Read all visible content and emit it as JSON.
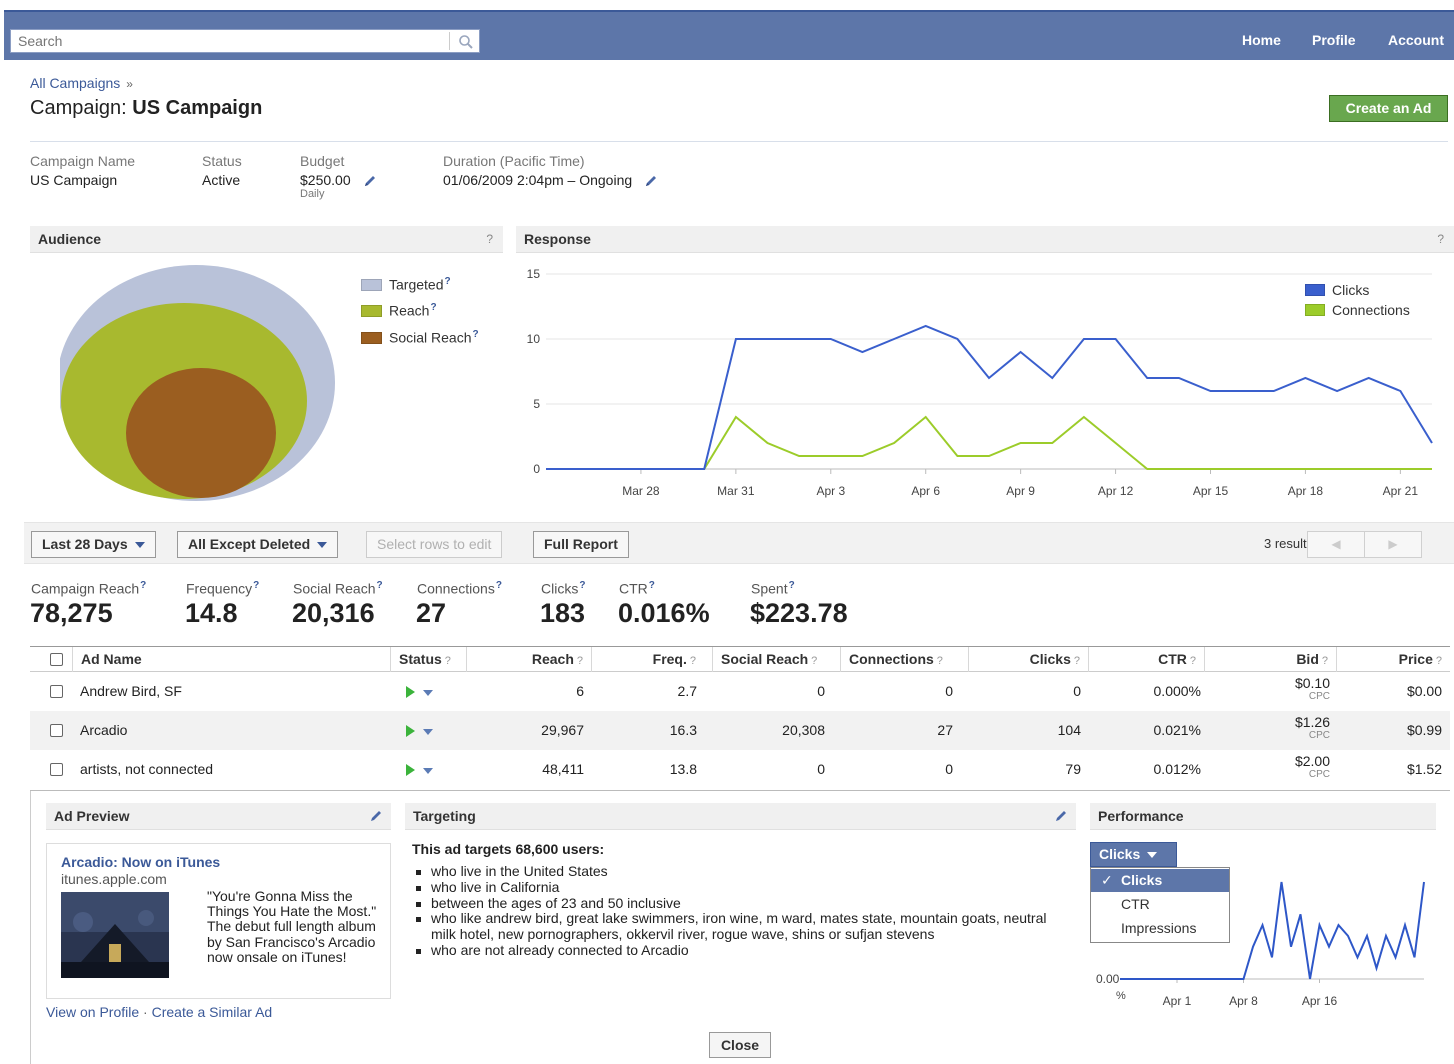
{
  "topbar": {
    "search_placeholder": "Search",
    "nav": [
      "Home",
      "Profile",
      "Account"
    ]
  },
  "breadcrumb": {
    "link": "All Campaigns",
    "sep": "»"
  },
  "page_title": {
    "prefix": "Campaign:",
    "name": "US Campaign"
  },
  "create_ad_label": "Create an Ad",
  "campaign_meta": {
    "name_label": "Campaign Name",
    "name_value": "US Campaign",
    "status_label": "Status",
    "status_value": "Active",
    "budget_label": "Budget",
    "budget_value": "$250.00",
    "budget_period": "Daily",
    "duration_label": "Duration (Pacific Time)",
    "duration_value": "01/06/2009 2:04pm – Ongoing"
  },
  "audience": {
    "title": "Audience",
    "help": "?",
    "legend": [
      {
        "label": "Targeted",
        "color": "#b9c2d9"
      },
      {
        "label": "Reach",
        "color": "#a8b92f"
      },
      {
        "label": "Social Reach",
        "color": "#9b5e20"
      }
    ]
  },
  "response": {
    "title": "Response",
    "help": "?",
    "legend": [
      {
        "label": "Clicks",
        "color": "#3a5fcd"
      },
      {
        "label": "Connections",
        "color": "#9ccc2a"
      }
    ]
  },
  "chart_data": [
    {
      "type": "line",
      "title": "Response",
      "x": [
        "Mar 25",
        "Mar 26",
        "Mar 27",
        "Mar 28",
        "Mar 29",
        "Mar 30",
        "Mar 31",
        "Apr 1",
        "Apr 2",
        "Apr 3",
        "Apr 4",
        "Apr 5",
        "Apr 6",
        "Apr 7",
        "Apr 8",
        "Apr 9",
        "Apr 10",
        "Apr 11",
        "Apr 12",
        "Apr 13",
        "Apr 14",
        "Apr 15",
        "Apr 16",
        "Apr 17",
        "Apr 18",
        "Apr 19",
        "Apr 20",
        "Apr 21"
      ],
      "x_tick_labels": [
        "Mar 28",
        "Mar 31",
        "Apr 3",
        "Apr 6",
        "Apr 9",
        "Apr 12",
        "Apr 15",
        "Apr 18",
        "Apr 21"
      ],
      "y_ticks": [
        0,
        5,
        10,
        15
      ],
      "ylim": [
        0,
        15
      ],
      "series": [
        {
          "name": "Clicks",
          "color": "#3a5fcd",
          "values": [
            0,
            0,
            0,
            0,
            0,
            0,
            10,
            10,
            10,
            10,
            9,
            10,
            11,
            10,
            7,
            9,
            7,
            10,
            10,
            7,
            7,
            6,
            6,
            6,
            7,
            6,
            7,
            6,
            2
          ]
        },
        {
          "name": "Connections",
          "color": "#9ccc2a",
          "values": [
            0,
            0,
            0,
            0,
            0,
            0,
            4,
            2,
            1,
            1,
            1,
            2,
            4,
            1,
            1,
            2,
            2,
            4,
            2,
            0,
            0,
            0,
            0,
            0,
            0,
            0,
            0,
            0,
            0
          ]
        }
      ],
      "legend_position": "top-right",
      "grid": true
    },
    {
      "type": "line",
      "title": "Performance",
      "x_tick_labels": [
        "Apr 1",
        "Apr 8",
        "Apr 16"
      ],
      "y_tick_labels": [
        "0.00"
      ],
      "y_unit": "%",
      "series": [
        {
          "name": "Clicks",
          "color": "#2e57c8",
          "values": [
            0,
            0,
            0,
            0,
            0,
            0,
            0,
            0,
            0,
            0,
            0,
            0,
            0,
            0,
            0.03,
            0.05,
            0.02,
            0.09,
            0.03,
            0.06,
            0.0,
            0.05,
            0.03,
            0.05,
            0.04,
            0.02,
            0.04,
            0.01,
            0.04,
            0.02,
            0.05,
            0.02,
            0.09
          ]
        }
      ]
    }
  ],
  "toolbar": {
    "date_range": "Last 28 Days",
    "filter": "All Except Deleted",
    "edit_rows": "Select rows to edit",
    "full_report": "Full Report",
    "results": "3 results"
  },
  "stats": [
    {
      "label": "Campaign Reach",
      "value": "78,275"
    },
    {
      "label": "Frequency",
      "value": "14.8"
    },
    {
      "label": "Social Reach",
      "value": "20,316"
    },
    {
      "label": "Connections",
      "value": "27"
    },
    {
      "label": "Clicks",
      "value": "183"
    },
    {
      "label": "CTR",
      "value": "0.016%"
    },
    {
      "label": "Spent",
      "value": "$223.78"
    }
  ],
  "table": {
    "columns": [
      "Ad Name",
      "Status",
      "Reach",
      "Freq.",
      "Social Reach",
      "Connections",
      "Clicks",
      "CTR",
      "Bid",
      "Price"
    ],
    "rows": [
      {
        "name": "Andrew Bird, SF",
        "reach": "6",
        "freq": "2.7",
        "social": "0",
        "connections": "0",
        "clicks": "0",
        "ctr": "0.000%",
        "bid": "$0.10",
        "bid_unit": "CPC",
        "price": "$0.00"
      },
      {
        "name": "Arcadio",
        "reach": "29,967",
        "freq": "16.3",
        "social": "20,308",
        "connections": "27",
        "clicks": "104",
        "ctr": "0.021%",
        "bid": "$1.26",
        "bid_unit": "CPC",
        "price": "$0.99"
      },
      {
        "name": "artists, not connected",
        "reach": "48,411",
        "freq": "13.8",
        "social": "0",
        "connections": "0",
        "clicks": "79",
        "ctr": "0.012%",
        "bid": "$2.00",
        "bid_unit": "CPC",
        "price": "$1.52"
      }
    ]
  },
  "ad_preview": {
    "title": "Ad Preview",
    "ad_title": "Arcadio: Now on iTunes",
    "ad_url": "itunes.apple.com",
    "ad_body": "\"You're Gonna Miss the Things You Hate the Most.\" The debut full length album by San Francisco's Arcadio now onsale on iTunes!",
    "view_profile": "View on Profile",
    "link_sep": "·",
    "create_similar": "Create a Similar Ad"
  },
  "targeting": {
    "title": "Targeting",
    "heading": "This ad targets 68,600 users:",
    "items": [
      "who live in the United States",
      "who live in California",
      "between the ages of 23 and 50 inclusive",
      "who like andrew bird, great lake swimmers, iron wine, m ward, mates state, mountain goats, neutral milk hotel, new pornographers, okkervil river, rogue wave, shins or sufjan stevens",
      "who are not already connected to Arcadio"
    ]
  },
  "performance": {
    "title": "Performance",
    "selected": "Clicks",
    "options": [
      "Clicks",
      "CTR",
      "Impressions"
    ],
    "checkmark": "✓"
  },
  "close_label": "Close"
}
